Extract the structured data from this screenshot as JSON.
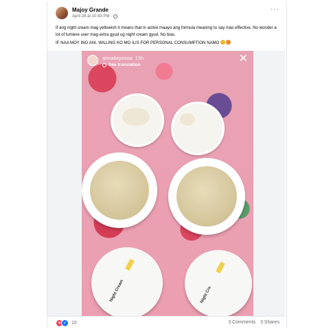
{
  "post": {
    "author": "Majoy Grande",
    "date": "April 28 at 10:43 PM",
    "separator": "·",
    "more_icon": "ellipsis-icon",
    "caption_line1": "If ang night cream mag yellowish it means that ni active maayo ang formula meaning to say mas effective. No wonder a lot of lumiere user mag extra gyud ug night cream gyud. No bias.",
    "caption_line2": "IF NAA MOY ING ANI. WILLING KO MO ILIS FOR PERSONAL CONSUMPTION NAMO"
  },
  "story": {
    "username": "annalisyosoo",
    "time": "19h",
    "translate": "See translation",
    "close": "✕",
    "jar_label_1": "Night Cream",
    "jar_label_2": "Night Cre"
  },
  "footer": {
    "reaction_count": "10",
    "comments": "3 Comments",
    "shares": "3 Shares",
    "colors": {
      "love": "#f33e58",
      "like": "#1877f2"
    }
  }
}
